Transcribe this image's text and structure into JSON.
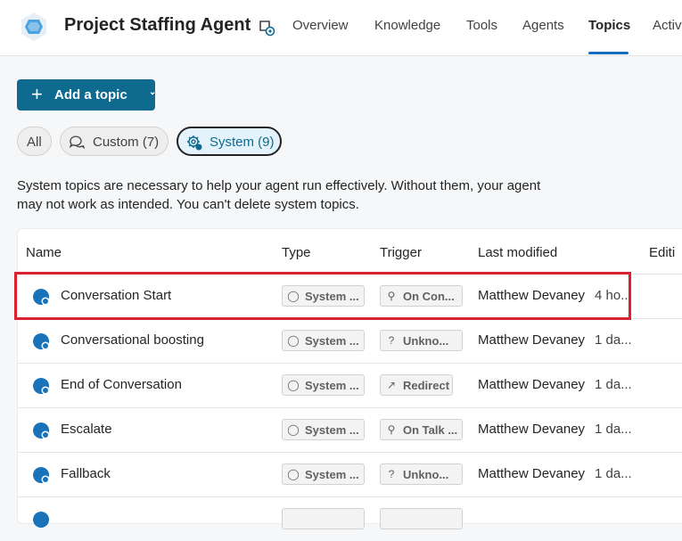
{
  "app": {
    "title": "Project Staffing Agent"
  },
  "tabs": [
    {
      "label": "Overview"
    },
    {
      "label": "Knowledge"
    },
    {
      "label": "Tools"
    },
    {
      "label": "Agents"
    },
    {
      "label": "Topics",
      "active": true
    },
    {
      "label": "Activ"
    }
  ],
  "toolbar": {
    "add_topic_label": "Add a topic"
  },
  "filters": {
    "all": "All",
    "custom": "Custom (7)",
    "system": "System (9)",
    "selected": "System (9)"
  },
  "description": {
    "line1": "System topics are necessary to help your agent run effectively. Without them, your agent",
    "line2": "may not work as intended. You can't delete system topics."
  },
  "table": {
    "columns": [
      "Name",
      "Type",
      "Trigger",
      "Last modified",
      "Editi"
    ],
    "rows": [
      {
        "name": "Conversation Start",
        "type": "System ...",
        "trigger": "On Con...",
        "trigger_icon": "lightbulb-icon",
        "modified_by": "Matthew Devaney",
        "time": "4 ho...",
        "highlighted": true
      },
      {
        "name": "Conversational boosting",
        "type": "System ...",
        "trigger": "Unkno...",
        "trigger_icon": "question-icon",
        "modified_by": "Matthew Devaney",
        "time": "1 da..."
      },
      {
        "name": "End of Conversation",
        "type": "System ...",
        "trigger": "Redirect",
        "trigger_icon": "redirect-icon",
        "modified_by": "Matthew Devaney",
        "time": "1 da..."
      },
      {
        "name": "Escalate",
        "type": "System ...",
        "trigger": "On Talk ...",
        "trigger_icon": "lightbulb-icon",
        "modified_by": "Matthew Devaney",
        "time": "1 da..."
      },
      {
        "name": "Fallback",
        "type": "System ...",
        "trigger": "Unkno...",
        "trigger_icon": "question-icon",
        "modified_by": "Matthew Devaney",
        "time": "1 da..."
      }
    ]
  },
  "colors": {
    "accent": "#0f6a8f",
    "highlight": "#d9232e",
    "topic_icon": "#1a73b8"
  }
}
